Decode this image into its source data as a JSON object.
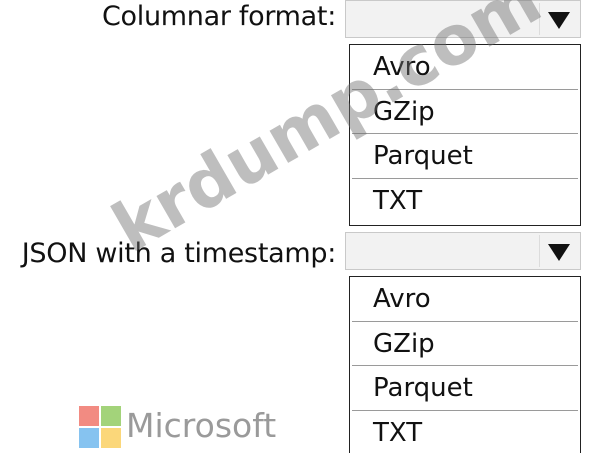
{
  "questions": [
    {
      "label": "Columnar format:",
      "selected": "",
      "options": [
        "Avro",
        "GZip",
        "Parquet",
        "TXT"
      ]
    },
    {
      "label": "JSON with a timestamp:",
      "selected": "",
      "options": [
        "Avro",
        "GZip",
        "Parquet",
        "TXT"
      ]
    }
  ],
  "branding": {
    "logo_icon": "microsoft-logo-icon",
    "logo_text": "Microsoft",
    "colors": {
      "red": "#f28b82",
      "green": "#a3d37a",
      "blue": "#86c3f0",
      "yellow": "#fbd77a"
    }
  },
  "watermark": {
    "text": "krdump.com"
  }
}
